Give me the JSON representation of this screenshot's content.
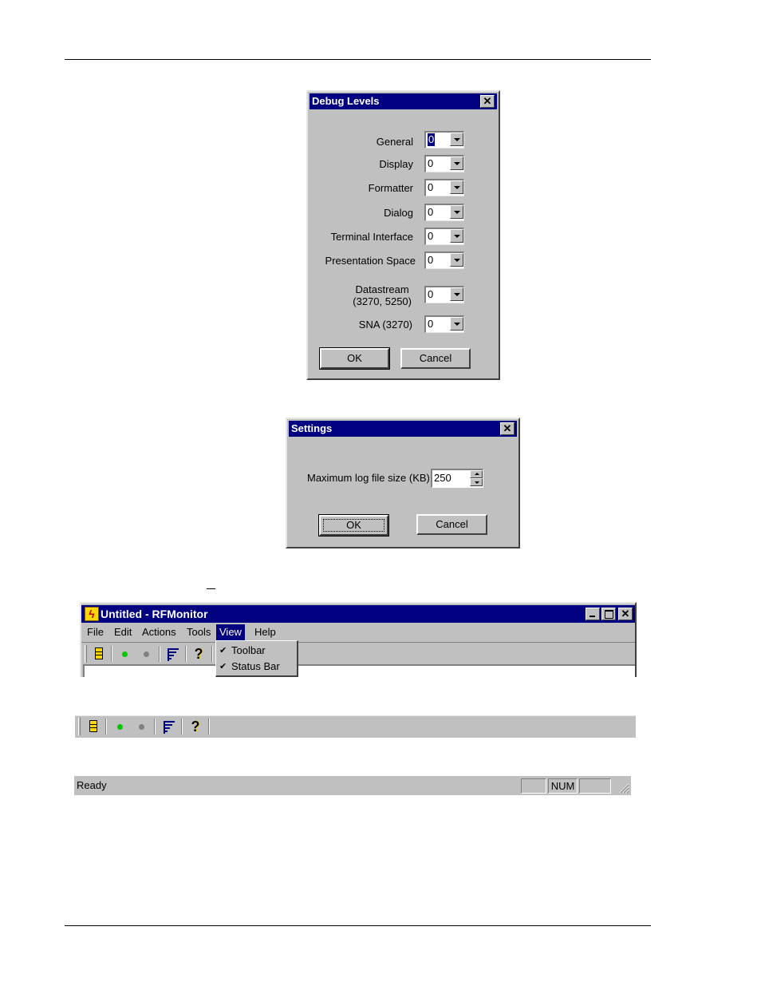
{
  "debug_dialog": {
    "title": "Debug Levels",
    "close_symbol": "✕",
    "rows": [
      {
        "label": "General",
        "value": "0"
      },
      {
        "label": "Display",
        "value": "0"
      },
      {
        "label": "Formatter",
        "value": "0"
      },
      {
        "label": "Dialog",
        "value": "0"
      },
      {
        "label": "Terminal Interface",
        "value": "0"
      },
      {
        "label": "Presentation Space",
        "value": "0"
      },
      {
        "label_line1": "Datastream",
        "label_line2": "(3270, 5250)",
        "value": "0"
      },
      {
        "label": "SNA (3270)",
        "value": "0"
      }
    ],
    "ok_label": "OK",
    "cancel_label": "Cancel"
  },
  "settings_dialog": {
    "title": "Settings",
    "close_symbol": "✕",
    "max_log_label": "Maximum log file size (KB) :",
    "max_log_value": "250",
    "ok_label": "OK",
    "cancel_label": "Cancel"
  },
  "main_window": {
    "title": "Untitled - RFMonitor",
    "menu": [
      "File",
      "Edit",
      "Actions",
      "Tools",
      "View",
      "Help"
    ],
    "view_menu_items": [
      {
        "label": "Toolbar",
        "checked": true
      },
      {
        "label": "Status Bar",
        "checked": true
      }
    ],
    "check_symbol": "✔"
  },
  "toolbar_icons": [
    "panel-icon",
    "green-dot-icon",
    "gray-dot-icon",
    "lines-icon",
    "help-icon"
  ],
  "statusbar": {
    "ready_text": "Ready",
    "num_indicator": "NUM"
  },
  "colors": {
    "titlebar": "#000080",
    "face": "#c0c0c0",
    "green": "#00c800",
    "gray_dot": "#808080"
  }
}
